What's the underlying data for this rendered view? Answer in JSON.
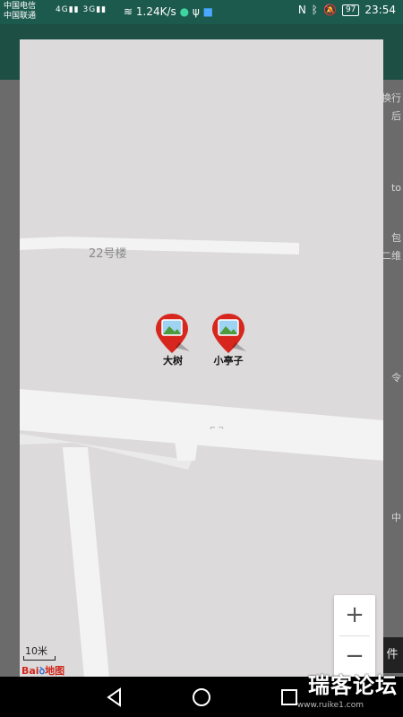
{
  "status_bar": {
    "carrier1": "中国电信",
    "carrier2": "中国联通",
    "net1": "4G",
    "net2": "3G",
    "speed": "1.24K/s",
    "battery": "97",
    "time": "23:54"
  },
  "background": {
    "frag1": "换行",
    "frag2": "后",
    "frag3": "to",
    "frag4": "包",
    "frag5": "二维",
    "frag6": "令",
    "frag7": "中",
    "frag8": "件"
  },
  "map": {
    "building_label": "22号楼",
    "markers": [
      {
        "label": "大树"
      },
      {
        "label": "小亭子"
      }
    ],
    "zoom_in": "+",
    "zoom_out": "−",
    "scale": "10米",
    "logo_text": "Bai",
    "logo_text2": "地图"
  },
  "watermark": {
    "text": "瑞客论坛",
    "sub": "www.ruike1.com"
  },
  "colors": {
    "marker": "#d7261e",
    "road": "#f3f3f3",
    "ground": "#dcdada",
    "status_bar": "#1c5a4e"
  }
}
